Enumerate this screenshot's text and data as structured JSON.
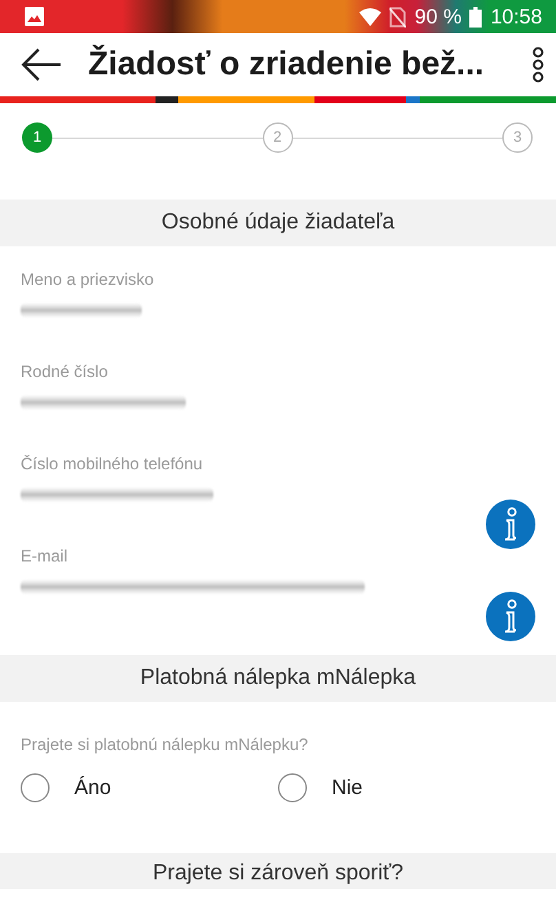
{
  "status_bar": {
    "battery": "90 %",
    "time": "10:58"
  },
  "toolbar": {
    "title": "Žiadosť o zriadenie bež..."
  },
  "stepper": [
    {
      "label": "1",
      "selected": true
    },
    {
      "label": "2",
      "selected": false
    },
    {
      "label": "3",
      "selected": false
    }
  ],
  "sections": [
    {
      "title": "Osobné údaje žiadateľa",
      "fields": [
        {
          "label": "Meno a priezvisko",
          "info": false
        },
        {
          "label": "Rodné číslo",
          "info": false
        },
        {
          "label": "Číslo mobilného telefónu",
          "info": true
        },
        {
          "label": "E-mail",
          "info": true
        }
      ]
    },
    {
      "title": "Platobná nálepka mNálepka",
      "question": "Prajete si platobnú nálepku mNálepku?",
      "options": [
        {
          "label": "Áno",
          "selected": false
        },
        {
          "label": "Nie",
          "selected": false
        }
      ]
    },
    {
      "title": "Prajete si zároveň sporiť?"
    }
  ]
}
